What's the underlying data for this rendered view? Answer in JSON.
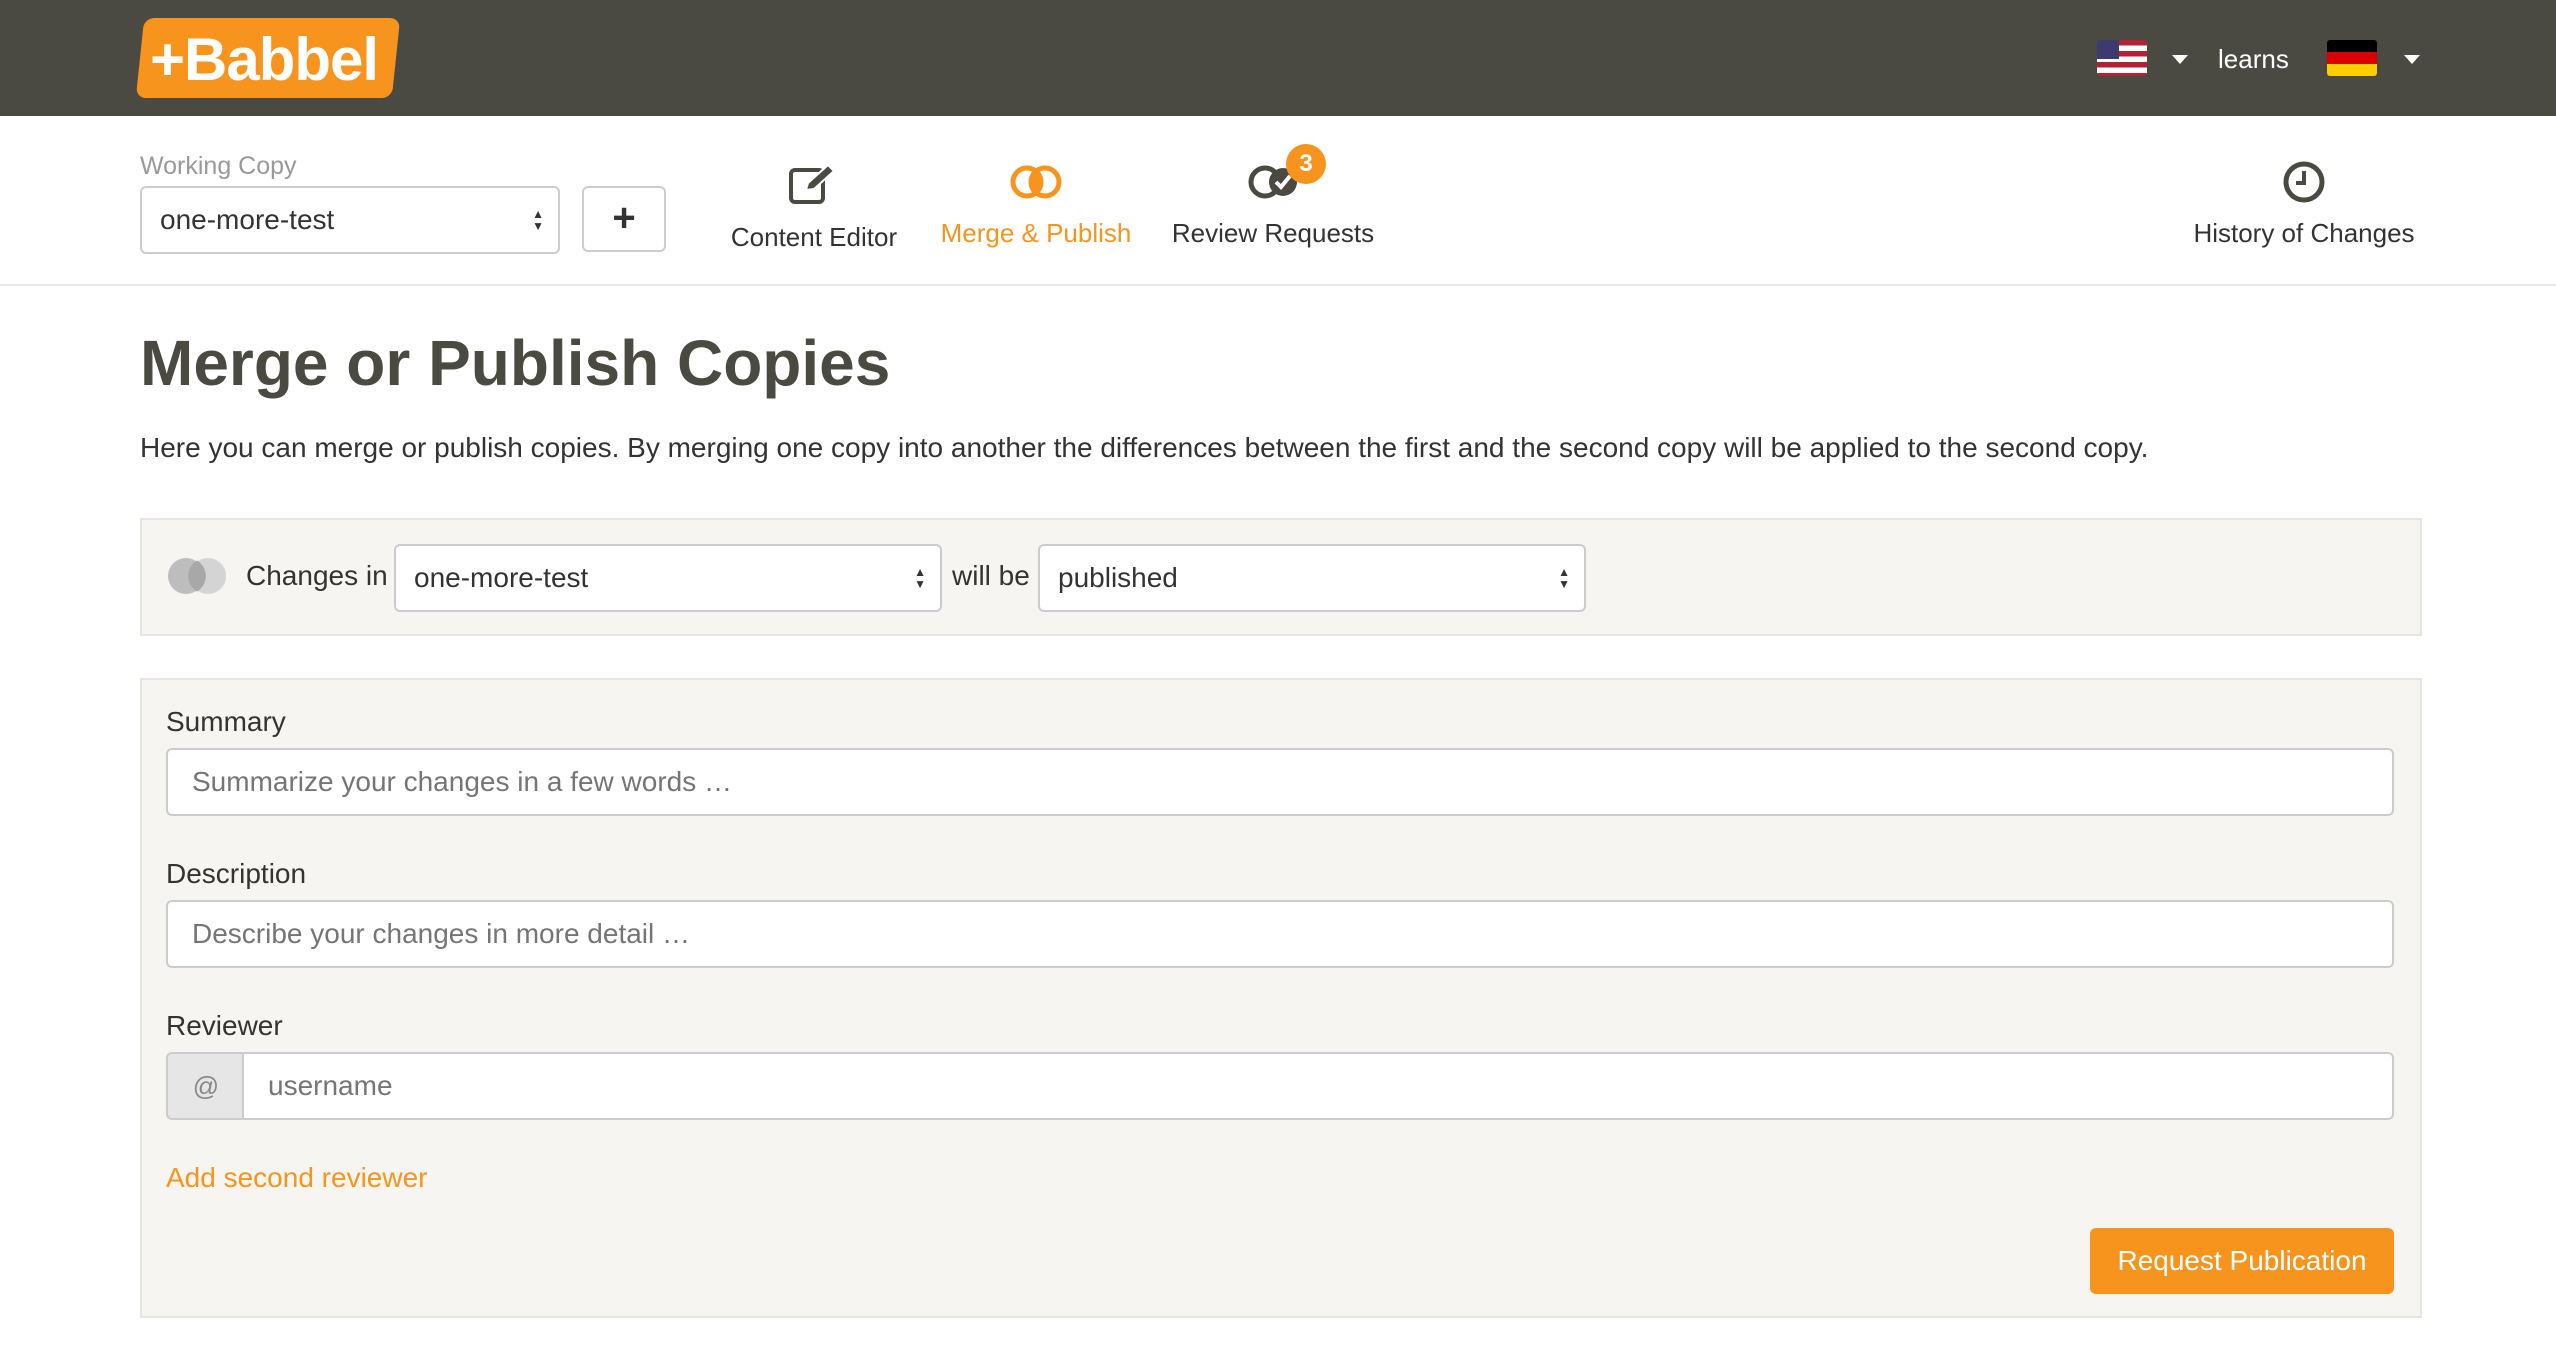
{
  "header": {
    "logo_text": "+Babbel",
    "source_language_flag": "us-flag-icon",
    "verb": "learns",
    "target_language_flag": "de-flag-icon"
  },
  "subnav": {
    "working_copy_label": "Working Copy",
    "working_copy_value": "one-more-test",
    "add_button_label": "+",
    "tabs": [
      {
        "label": "Content Editor",
        "icon": "edit-icon",
        "active": false
      },
      {
        "label": "Merge & Publish",
        "icon": "merge-icon",
        "active": true
      },
      {
        "label": "Review Requests",
        "icon": "review-icon",
        "active": false,
        "badge": "3"
      },
      {
        "label": "History of Changes",
        "icon": "clock-icon",
        "active": false
      }
    ]
  },
  "main": {
    "title": "Merge or Publish Copies",
    "intro": "Here you can merge or publish copies. By merging one copy into another the differences between the first and the second copy will be applied to the second copy.",
    "merge_bar": {
      "changes_in_label": "Changes in",
      "source_value": "one-more-test",
      "will_be_label": "will be",
      "target_value": "published"
    },
    "form": {
      "summary_label": "Summary",
      "summary_placeholder": "Summarize your changes in a few words …",
      "description_label": "Description",
      "description_placeholder": "Describe your changes in more detail …",
      "reviewer_label": "Reviewer",
      "reviewer_addon": "@",
      "reviewer_placeholder": "username",
      "add_reviewer_link": "Add second reviewer",
      "submit_label": "Request Publication"
    }
  },
  "colors": {
    "accent": "#f7941d",
    "header_bg": "#4a4a42",
    "panel_bg": "#f6f5f1"
  }
}
